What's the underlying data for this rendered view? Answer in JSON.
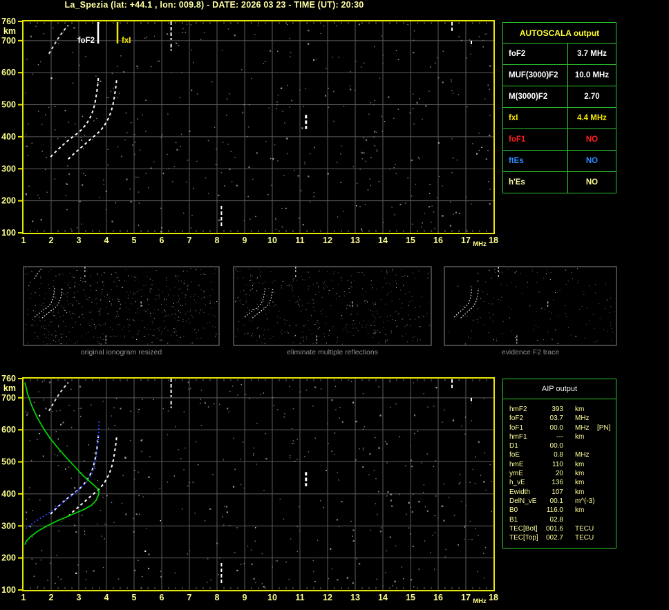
{
  "title": "La_Spezia (lat: +44.1 , lon: 009.8) - DATE: 2026 03 23 - TIME (UT): 20:30",
  "colors": {
    "background": "#000000",
    "plot_border": "#e8e800",
    "grid": "#5c5c5c",
    "axis_text": "#ffff8c",
    "table_border": "#2ec82e",
    "table_header_yellow": "#ffff2e",
    "white": "#ffffff",
    "yellow": "#f5e900",
    "red": "#ff2020",
    "blue": "#2e8cff",
    "khaki": "#ffffaa",
    "caption_gray": "#8f8f8f",
    "profile_green": "#00d200",
    "restored_blue": "#2f3fff"
  },
  "autoscala_table": {
    "header": "AUTOSCALA output",
    "rows": [
      {
        "label": "foF2",
        "value": "3.7 MHz",
        "label_color": "#ffffff",
        "value_color": "#ffffff"
      },
      {
        "label": "MUF(3000)F2",
        "value": "10.0 MHz",
        "label_color": "#ffffff",
        "value_color": "#ffffff"
      },
      {
        "label": "M(3000)F2",
        "value": "2.70",
        "label_color": "#ffffff",
        "value_color": "#ffffff"
      },
      {
        "label": "fxI",
        "value": "4.4 MHz",
        "label_color": "#f5e900",
        "value_color": "#f5e900"
      },
      {
        "label": "foF1",
        "value": "NO",
        "label_color": "#ff2020",
        "value_color": "#ff2020"
      },
      {
        "label": "ftEs",
        "value": "NO",
        "label_color": "#2e8cff",
        "value_color": "#2e8cff"
      },
      {
        "label": "h'Es",
        "value": "NO",
        "label_color": "#ffffaa",
        "value_color": "#ffff8c"
      }
    ]
  },
  "aip_table": {
    "header": "AIP output",
    "rows": [
      {
        "label": "hmF2",
        "value": "393",
        "unit": "km",
        "extra": ""
      },
      {
        "label": "foF2",
        "value": "03.7",
        "unit": "MHz",
        "extra": ""
      },
      {
        "label": "foF1",
        "value": "00.0",
        "unit": "MHz",
        "extra": "[PN]"
      },
      {
        "label": "hmF1",
        "value": "---",
        "unit": "km",
        "extra": ""
      },
      {
        "label": "D1",
        "value": "00.0",
        "unit": "",
        "extra": ""
      },
      {
        "label": "foE",
        "value": "0.8",
        "unit": "MHz",
        "extra": ""
      },
      {
        "label": "hmE",
        "value": "110",
        "unit": "km",
        "extra": ""
      },
      {
        "label": "ymE",
        "value": "20",
        "unit": "km",
        "extra": ""
      },
      {
        "label": "h_vE",
        "value": "136",
        "unit": "km",
        "extra": ""
      },
      {
        "label": "Ewidth",
        "value": "107",
        "unit": "km",
        "extra": ""
      },
      {
        "label": "DelN_vE",
        "value": "00.1",
        "unit": "m^(-3)",
        "extra": ""
      },
      {
        "label": "B0",
        "value": "116.0",
        "unit": "km",
        "extra": ""
      },
      {
        "label": "B1",
        "value": "02.8",
        "unit": "",
        "extra": ""
      },
      {
        "label": "TEC[Bot]",
        "value": "001.6",
        "unit": "TECU",
        "extra": ""
      },
      {
        "label": "TEC[Top]",
        "value": "002.7",
        "unit": "TECU",
        "extra": ""
      }
    ]
  },
  "thumbnails": [
    {
      "label": "original ionogram resized"
    },
    {
      "label": "eliminate multiple reflections"
    },
    {
      "label": "evidence F2 trace"
    }
  ],
  "traces": {
    "o_mode": [
      [
        1.98,
        337
      ],
      [
        2.15,
        352
      ],
      [
        2.32,
        366
      ],
      [
        2.5,
        380
      ],
      [
        2.68,
        393
      ],
      [
        2.85,
        404
      ],
      [
        3.0,
        414
      ],
      [
        3.12,
        424
      ],
      [
        3.22,
        434
      ],
      [
        3.32,
        446
      ],
      [
        3.4,
        458
      ],
      [
        3.47,
        471
      ],
      [
        3.53,
        486
      ],
      [
        3.58,
        503
      ],
      [
        3.62,
        522
      ],
      [
        3.66,
        544
      ],
      [
        3.69,
        566
      ],
      [
        3.71,
        585
      ]
    ],
    "x_mode": [
      [
        2.62,
        330
      ],
      [
        2.8,
        345
      ],
      [
        3.0,
        360
      ],
      [
        3.2,
        375
      ],
      [
        3.38,
        389
      ],
      [
        3.55,
        401
      ],
      [
        3.7,
        412
      ],
      [
        3.82,
        423
      ],
      [
        3.92,
        434
      ],
      [
        4.0,
        446
      ],
      [
        4.08,
        459
      ],
      [
        4.15,
        474
      ],
      [
        4.21,
        491
      ],
      [
        4.26,
        510
      ],
      [
        4.3,
        532
      ],
      [
        4.34,
        556
      ],
      [
        4.37,
        578
      ]
    ],
    "second_hop": [
      [
        1.92,
        659
      ],
      [
        2.05,
        678
      ],
      [
        2.2,
        700
      ],
      [
        2.35,
        719
      ],
      [
        2.5,
        736
      ],
      [
        2.62,
        748
      ]
    ],
    "restored": [
      [
        1.08,
        292
      ],
      [
        1.25,
        303
      ],
      [
        1.45,
        315
      ],
      [
        1.65,
        326
      ],
      [
        1.85,
        337
      ],
      [
        2.05,
        349
      ],
      [
        2.25,
        361
      ],
      [
        2.45,
        374
      ],
      [
        2.62,
        386
      ],
      [
        2.78,
        397
      ],
      [
        2.95,
        409
      ],
      [
        3.1,
        421
      ],
      [
        3.22,
        432
      ],
      [
        3.33,
        444
      ],
      [
        3.42,
        456
      ],
      [
        3.5,
        470
      ],
      [
        3.56,
        486
      ],
      [
        3.61,
        505
      ],
      [
        3.65,
        528
      ],
      [
        3.68,
        553
      ],
      [
        3.71,
        582
      ],
      [
        3.73,
        612
      ],
      [
        3.74,
        628
      ]
    ],
    "profile": [
      [
        1.05,
        748
      ],
      [
        1.15,
        712
      ],
      [
        1.3,
        675
      ],
      [
        1.5,
        638
      ],
      [
        1.72,
        605
      ],
      [
        1.95,
        575
      ],
      [
        2.2,
        548
      ],
      [
        2.5,
        518
      ],
      [
        2.8,
        490
      ],
      [
        3.1,
        462
      ],
      [
        3.35,
        442
      ],
      [
        3.55,
        427
      ],
      [
        3.68,
        416
      ],
      [
        3.73,
        407
      ],
      [
        3.71,
        396
      ],
      [
        3.62,
        379
      ],
      [
        3.45,
        364
      ],
      [
        3.2,
        352
      ],
      [
        2.9,
        341
      ],
      [
        2.55,
        328
      ],
      [
        2.2,
        315
      ],
      [
        1.85,
        300
      ],
      [
        1.5,
        283
      ],
      [
        1.25,
        266
      ],
      [
        1.1,
        252
      ],
      [
        1.05,
        241
      ]
    ],
    "rfi_segments": [
      [
        6.34,
        760,
        702
      ],
      [
        6.34,
        690,
        668
      ],
      [
        11.22,
        468,
        424
      ],
      [
        8.16,
        184,
        115
      ],
      [
        16.5,
        758,
        728
      ],
      [
        17.2,
        700,
        682
      ]
    ]
  },
  "chart_data": [
    {
      "id": "top_ionogram",
      "type": "scatter",
      "title": "autoscaled ionogram",
      "xlabel": "MHz",
      "ylabel": "km",
      "xlim": [
        1,
        18
      ],
      "ylim": [
        100,
        760
      ],
      "xticks": [
        1,
        2,
        3,
        4,
        5,
        6,
        7,
        8,
        9,
        10,
        11,
        12,
        13,
        14,
        15,
        16,
        17,
        18
      ],
      "yticks": [
        760,
        700,
        600,
        500,
        400,
        300,
        200,
        100
      ],
      "grid": true,
      "annotations": [
        {
          "label": "foF2",
          "x_mhz": 3.7,
          "color": "#ffffff",
          "side": "left"
        },
        {
          "label": "fxI",
          "x_mhz": 4.4,
          "color": "#f5e900",
          "side": "right"
        }
      ],
      "series": [
        {
          "name": "F2-o-mode-echo-trace",
          "style": "dashed",
          "color": "#ffffff",
          "points_ref": "o_mode"
        },
        {
          "name": "F2-x-mode-echo-trace",
          "style": "dashed",
          "color": "#ffffff",
          "points_ref": "x_mode"
        },
        {
          "name": "second-hop-multiple-trace",
          "style": "dashed",
          "color": "#e0e0e0",
          "points_ref": "second_hop"
        },
        {
          "name": "rfi-vertical-lines",
          "style": "segments",
          "color": "#ffffff",
          "segments_ref": "rfi_segments"
        }
      ]
    },
    {
      "id": "bottom_ionogram",
      "type": "scatter",
      "title": "AIP inversion result",
      "xlabel": "MHz",
      "ylabel": "km",
      "xlim": [
        1,
        18
      ],
      "ylim": [
        100,
        760
      ],
      "xticks": [
        1,
        2,
        3,
        4,
        5,
        6,
        7,
        8,
        9,
        10,
        11,
        12,
        13,
        14,
        15,
        16,
        17,
        18
      ],
      "yticks": [
        760,
        700,
        600,
        500,
        400,
        300,
        200,
        100
      ],
      "grid": true,
      "annotations": [],
      "series": [
        {
          "name": "F2-o-mode-echo-trace",
          "style": "dashed",
          "color": "#ffffff",
          "points_ref": "o_mode"
        },
        {
          "name": "F2-x-mode-echo-trace",
          "style": "dashed",
          "color": "#ffffff",
          "points_ref": "x_mode"
        },
        {
          "name": "second-hop-multiple-trace",
          "style": "dashed",
          "color": "#e0e0e0",
          "points_ref": "second_hop"
        },
        {
          "name": "rfi-vertical-lines",
          "style": "segments",
          "color": "#ffffff",
          "segments_ref": "rfi_segments"
        },
        {
          "name": "restored-true-height-trace",
          "style": "dotted",
          "color": "#2f3fff",
          "points_ref": "restored"
        },
        {
          "name": "electron-density-profile",
          "style": "solid",
          "color": "#00d200",
          "points_ref": "profile"
        }
      ]
    }
  ],
  "axis": {
    "x_unit": "MHz",
    "y_unit": "km"
  }
}
